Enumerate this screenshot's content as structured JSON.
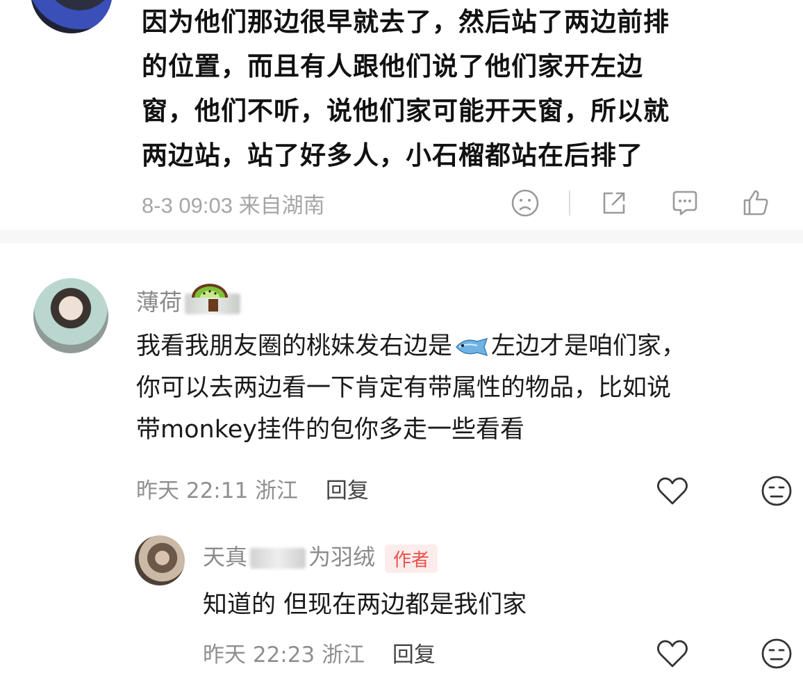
{
  "comment1": {
    "lines": [
      "因为他们那边很早就去了，然后站了两边前排",
      "的位置，而且有人跟他们说了他们家开左边",
      "窗，他们不听，说他们家可能开天窗，所以就",
      "两边站，站了好多人，小石榴都站在后排了"
    ],
    "meta": "8-3 09:03 来自湖南",
    "actions": [
      "sad-face-icon",
      "share-icon",
      "comment-icon",
      "like-icon"
    ]
  },
  "comment2": {
    "username": "薄荷",
    "lines": {
      "line1_before": "我看我朋友圈的桃妹发右边是",
      "line1_after": "左边才是咱们家，",
      "line2": "你可以去两边看一下肯定有带属性的物品，比如说",
      "line3": "带monkey挂件的包你多走一些看看"
    },
    "time": "昨天 22:11",
    "location": "浙江",
    "reply_label": "回复"
  },
  "reply": {
    "username_prefix": "天真",
    "username_suffix": "为羽绒",
    "badge": "作者",
    "text": "知道的 但现在两边都是我们家",
    "time": "昨天 22:23",
    "location": "浙江",
    "reply_label": "回复"
  },
  "colors": {
    "text": "#1a1a1a",
    "meta": "#8f8f8f",
    "badge": "#e9504a",
    "badge_bg": "#fdecec"
  }
}
